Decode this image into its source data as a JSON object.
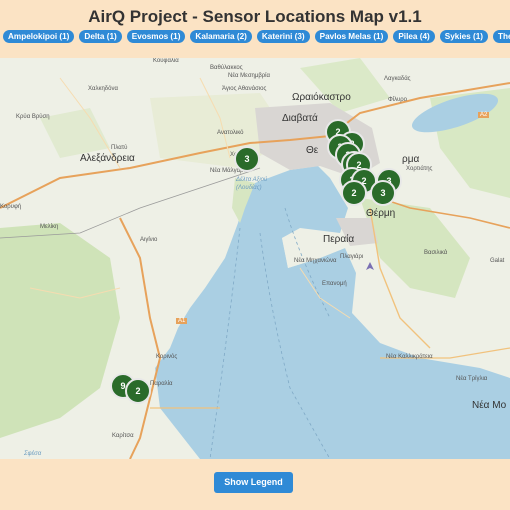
{
  "title": "AirQ Project - Sensor Locations Map v1.1",
  "filters": [
    "Ampelokipoi (1)",
    "Delta (1)",
    "Evosmos (1)",
    "Kalamaria (2)",
    "Katerini (3)",
    "Pavlos Melas (1)",
    "Pilea (4)",
    "Sykies (1)",
    "Thessalo"
  ],
  "map_labels": {
    "koufalia": "Κουφάλια",
    "vathylakkos": "Βαθύλακκος",
    "nea_mesimvria": "Νέα Μεσημβρία",
    "chalkidona": "Χαλκηδόνα",
    "agios_athanasios": "Άγιος Αθανάσιος",
    "oraiokastro": "Ωραιόκαστρο",
    "filyro": "Φίλυρο",
    "lagkadas": "Λαγκαδάς",
    "krya_vrysi": "Κρύα Βρύση",
    "diavata": "Διαβατά",
    "anatoliko": "Ανατολικό",
    "chalastra": "Χαλάστρα",
    "thessaloniki_short": "Θε",
    "platy": "Πλατύ",
    "alexandreia": "Αλεξάνδρεια",
    "nea_magnisia": "Νέα Μάλγαρα",
    "delta_axiou": "Δέλτα Αξιού (Λουδίας)",
    "chortiatis": "Χορτιάτης",
    "thermi_short": "ρμα",
    "thermi": "Θέρμη",
    "korifi": "Κορυφή",
    "meliki": "Μελίκη",
    "aiginio": "Αιγίνιο",
    "peraia": "Περαία",
    "plagiari": "Πλαγιάρι",
    "vasilika": "Βασιλικά",
    "nea_michaniona": "Νέα Μηχανιώνα",
    "epanomi": "Επανομή",
    "galatista": "Galat",
    "a1": "A1",
    "a2": "A2",
    "karyes": "Καρίτσα",
    "korinos": "Κορινός",
    "paralia": "Παραλία",
    "nea_kallikrateia": "Νέα Καλλικράτεια",
    "nea_triglia": "Νέα Τρίγλια",
    "nea_moudania": "Νέα Μο",
    "karitsa": "Καρίτσα",
    "sfendami": "Σφέσα"
  },
  "clusters": [
    {
      "label": "3"
    },
    {
      "label": "2"
    },
    {
      "label": "2"
    },
    {
      "label": "2"
    },
    {
      "label": "3"
    },
    {
      "label": "3"
    },
    {
      "label": "2"
    },
    {
      "label": "2"
    },
    {
      "label": "2"
    },
    {
      "label": "3"
    },
    {
      "label": "3"
    },
    {
      "label": "2"
    },
    {
      "label": "9"
    },
    {
      "label": "2"
    }
  ],
  "legend_button": "Show Legend",
  "colors": {
    "background": "#fbe3c4",
    "accent": "#2f8ad6",
    "cluster": "#2a6b2a",
    "sea": "#aacfe3"
  }
}
